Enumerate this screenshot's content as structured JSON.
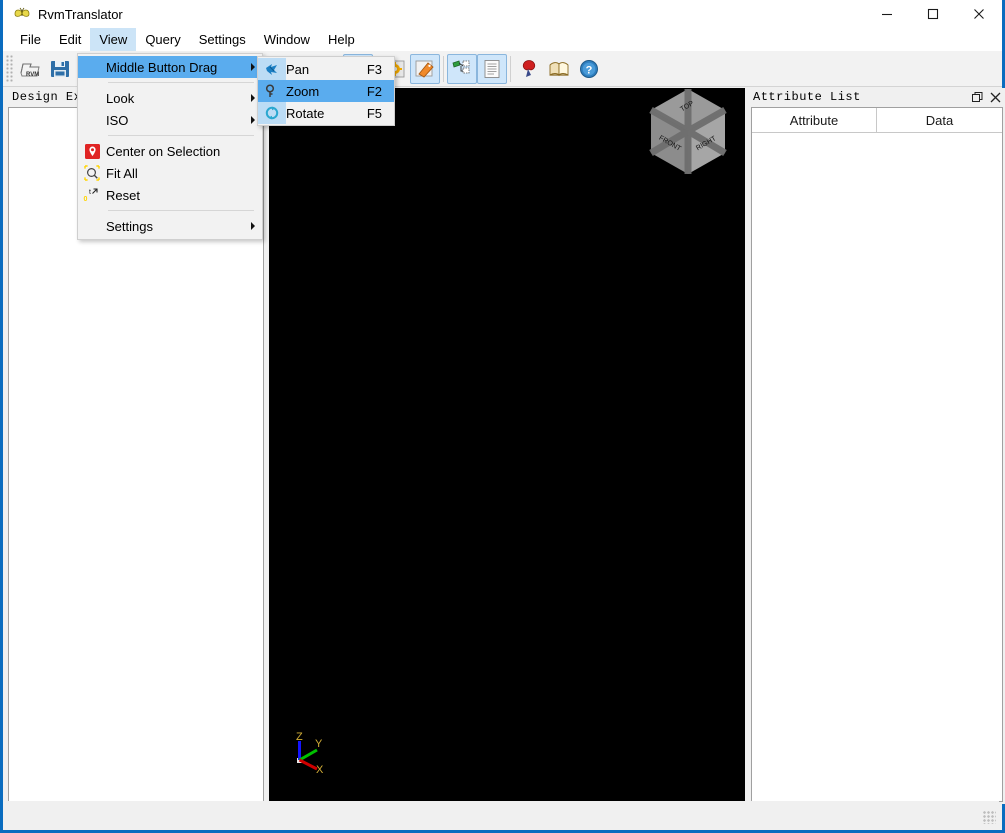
{
  "window": {
    "title": "RvmTranslator",
    "app_icon": "butterfly-icon",
    "controls": {
      "minimize": "minimize-icon",
      "maximize": "maximize-icon",
      "close": "close-icon"
    }
  },
  "menubar": {
    "items": [
      {
        "label": "File",
        "active": false
      },
      {
        "label": "Edit",
        "active": false
      },
      {
        "label": "View",
        "active": true
      },
      {
        "label": "Query",
        "active": false
      },
      {
        "label": "Settings",
        "active": false
      },
      {
        "label": "Window",
        "active": false
      },
      {
        "label": "Help",
        "active": false
      }
    ]
  },
  "toolbar": {
    "buttons": [
      {
        "name": "open-rvm-button",
        "icon": "open-rvm-folder-icon",
        "checked": false
      },
      {
        "name": "save-button",
        "icon": "floppy-save-icon",
        "checked": false
      },
      {
        "name": "view-top-button",
        "icon": "cube-top-icon",
        "checked": false
      },
      {
        "name": "view-bottom-button",
        "icon": "cube-bottom-icon",
        "checked": false
      },
      {
        "name": "rotate-left-button",
        "icon": "cube-rotate-1-icon",
        "checked": false
      },
      {
        "name": "rotate-right-button",
        "icon": "cube-rotate-2-icon",
        "checked": false
      },
      {
        "name": "rotate-up-button",
        "icon": "cube-rotate-3-icon",
        "checked": false
      },
      {
        "name": "rotate-down-button",
        "icon": "cube-rotate-4-icon",
        "checked": false
      },
      {
        "name": "fit-all-button",
        "icon": "fit-all-magnifier-icon",
        "checked": false
      },
      {
        "name": "reset-view-button",
        "icon": "reset-view-icon",
        "checked": false
      },
      {
        "name": "shaded-mode-button",
        "icon": "orange-cube-icon",
        "checked": true
      },
      {
        "name": "settings-button",
        "icon": "gear-icon",
        "checked": false
      },
      {
        "name": "tag-button",
        "icon": "orange-tag-icon",
        "checked": true
      },
      {
        "name": "design-explorer-button",
        "icon": "tree-explorer-icon",
        "checked": true
      },
      {
        "name": "attribute-list-button",
        "icon": "list-panel-icon",
        "checked": true
      },
      {
        "name": "seal-button",
        "icon": "red-seal-icon",
        "checked": false
      },
      {
        "name": "manual-button",
        "icon": "open-book-icon",
        "checked": false
      },
      {
        "name": "help-button",
        "icon": "help-question-icon",
        "checked": false
      }
    ]
  },
  "view_menu": {
    "items": [
      {
        "label": "Middle Button Drag",
        "icon": null,
        "accel": "",
        "submenu": true,
        "highlight": true
      },
      {
        "separator": true
      },
      {
        "label": "Look",
        "icon": null,
        "accel": "",
        "submenu": true,
        "highlight": false
      },
      {
        "label": "ISO",
        "icon": null,
        "accel": "",
        "submenu": true,
        "highlight": false
      },
      {
        "separator": true
      },
      {
        "label": "Center on Selection",
        "icon": "map-pin-icon",
        "accel": "",
        "submenu": false,
        "highlight": false
      },
      {
        "label": "Fit All",
        "icon": "fit-all-magnifier-icon",
        "accel": "",
        "submenu": false,
        "highlight": false
      },
      {
        "label": "Reset",
        "icon": "reset-view-icon",
        "accel": "",
        "submenu": false,
        "highlight": false
      },
      {
        "separator": true
      },
      {
        "label": "Settings",
        "icon": null,
        "accel": "",
        "submenu": true,
        "highlight": false
      }
    ]
  },
  "middle_button_drag_submenu": {
    "items": [
      {
        "label": "Pan",
        "accel": "F3",
        "icon": "pan-hand-icon",
        "highlight": false
      },
      {
        "label": "Zoom",
        "accel": "F2",
        "icon": "zoom-magnifier-icon",
        "highlight": true
      },
      {
        "label": "Rotate",
        "accel": "F5",
        "icon": "rotate-arrows-icon",
        "highlight": false
      }
    ]
  },
  "left_panel": {
    "caption": "Design Expl"
  },
  "right_panel": {
    "caption": "Attribute List",
    "restore_icon": "restore-panel-icon",
    "close_icon": "close-panel-icon",
    "columns": [
      "Attribute",
      "Data"
    ],
    "rows": []
  },
  "viewport": {
    "background": "#000000",
    "view_cube": {
      "faces": [
        "TOP",
        "FRONT",
        "RIGHT"
      ]
    },
    "axis_triad": {
      "labels": [
        "Z",
        "Y",
        "X"
      ],
      "colors": {
        "Z": "#0000ff",
        "Y": "#00c000",
        "X": "#d00000",
        "text": "#d4af37"
      }
    }
  },
  "statusbar": {
    "text": ""
  },
  "colors": {
    "window_border": "#0a6cbf",
    "menu_highlight": "#5aacee",
    "menubar_active": "#cce4f7",
    "toolbar_checked": "#cfe6fa",
    "panel_bg": "#f0f0f0"
  }
}
